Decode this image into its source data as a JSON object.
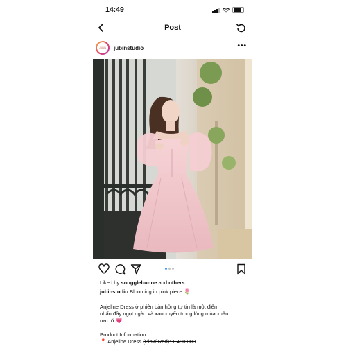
{
  "status_bar": {
    "time": "14:49"
  },
  "nav": {
    "title": "Post"
  },
  "profile": {
    "username": "jubinstudio",
    "avatar_text": "JUBIN"
  },
  "post": {
    "image_description_icon": "photo",
    "carousel": {
      "count": 3,
      "active": 0
    },
    "liked_by": {
      "prefix": "Liked by",
      "user": "snugglebunne",
      "middle": "and",
      "others": "others"
    },
    "caption": {
      "username": "jubinstudio",
      "text": "Blooming in pink piece 🌷"
    },
    "description_line1": "Anjeline Dress ở phiên bản hồng tự tin là một điểm",
    "description_line2": "nhấn đầy ngọt ngào và xao xuyến trong lòng mùa xuân",
    "description_line3": "rực rỡ 💗",
    "product_info_label": "Product Information:",
    "product_line_prefix": "📍 Anjeline Dress",
    "product_line_strike": "(Pink/ Red): 1.480.000"
  },
  "colors": {
    "accent": "#3897f0",
    "dress": "#f2c6cc"
  }
}
